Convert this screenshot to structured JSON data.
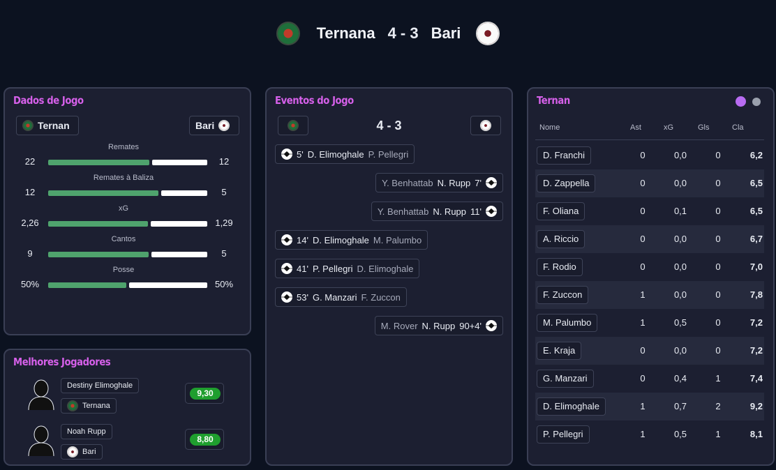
{
  "match": {
    "home": "Ternana",
    "away": "Bari",
    "score": "4 - 3"
  },
  "stats_panel": {
    "title": "Dados de Jogo",
    "home_chip": "Ternan",
    "away_chip": "Bari",
    "stats": [
      {
        "label": "Remates",
        "home": "22",
        "away": "12",
        "home_share": 0.647
      },
      {
        "label": "Remates à Baliza",
        "home": "12",
        "away": "5",
        "home_share": 0.706
      },
      {
        "label": "xG",
        "home": "2,26",
        "away": "1,29",
        "home_share": 0.637
      },
      {
        "label": "Cantos",
        "home": "9",
        "away": "5",
        "home_share": 0.643
      },
      {
        "label": "Posse",
        "home": "50%",
        "away": "50%",
        "home_share": 0.5
      }
    ]
  },
  "events_panel": {
    "title": "Eventos do Jogo",
    "score": "4 - 3",
    "events": [
      {
        "side": "home",
        "minute": "5'",
        "scorer": "D. Elimoghale",
        "assist": "P. Pellegri"
      },
      {
        "side": "away",
        "minute": "7'",
        "scorer": "N. Rupp",
        "assist": "Y. Benhattab"
      },
      {
        "side": "away",
        "minute": "11'",
        "scorer": "N. Rupp",
        "assist": "Y. Benhattab"
      },
      {
        "side": "home",
        "minute": "14'",
        "scorer": "D. Elimoghale",
        "assist": "M. Palumbo"
      },
      {
        "side": "home",
        "minute": "41'",
        "scorer": "P. Pellegri",
        "assist": "D. Elimoghale"
      },
      {
        "side": "home",
        "minute": "53'",
        "scorer": "G. Manzari",
        "assist": "F. Zuccon"
      },
      {
        "side": "away",
        "minute": "90+4'",
        "scorer": "N. Rupp",
        "assist": "M. Rover"
      }
    ]
  },
  "best_players_panel": {
    "title": "Melhores Jogadores",
    "players": [
      {
        "name": "Destiny Elimoghale",
        "team": "Ternana",
        "rating": "9,30"
      },
      {
        "name": "Noah Rupp",
        "team": "Bari",
        "rating": "8,80"
      }
    ]
  },
  "players_panel": {
    "title": "Ternan",
    "headers": {
      "name": "Nome",
      "ast": "Ast",
      "xg": "xG",
      "gls": "Gls",
      "cla": "Cla"
    },
    "toggle_colors": {
      "active": "#b86cf2",
      "inactive": "#9aa0ad"
    },
    "rows": [
      {
        "name": "D. Franchi",
        "ast": "0",
        "xg": "0,0",
        "gls": "0",
        "cla": "6,2"
      },
      {
        "name": "D. Zappella",
        "ast": "0",
        "xg": "0,0",
        "gls": "0",
        "cla": "6,5"
      },
      {
        "name": "F. Oliana",
        "ast": "0",
        "xg": "0,1",
        "gls": "0",
        "cla": "6,5"
      },
      {
        "name": "A. Riccio",
        "ast": "0",
        "xg": "0,0",
        "gls": "0",
        "cla": "6,7"
      },
      {
        "name": "F. Rodio",
        "ast": "0",
        "xg": "0,0",
        "gls": "0",
        "cla": "7,0"
      },
      {
        "name": "F. Zuccon",
        "ast": "1",
        "xg": "0,0",
        "gls": "0",
        "cla": "7,8"
      },
      {
        "name": "M. Palumbo",
        "ast": "1",
        "xg": "0,5",
        "gls": "0",
        "cla": "7,2"
      },
      {
        "name": "E. Kraja",
        "ast": "0",
        "xg": "0,0",
        "gls": "0",
        "cla": "7,2"
      },
      {
        "name": "G. Manzari",
        "ast": "0",
        "xg": "0,4",
        "gls": "1",
        "cla": "7,4"
      },
      {
        "name": "D. Elimoghale",
        "ast": "1",
        "xg": "0,7",
        "gls": "2",
        "cla": "9,2"
      },
      {
        "name": "P. Pellegri",
        "ast": "1",
        "xg": "0,5",
        "gls": "1",
        "cla": "8,1"
      }
    ]
  }
}
